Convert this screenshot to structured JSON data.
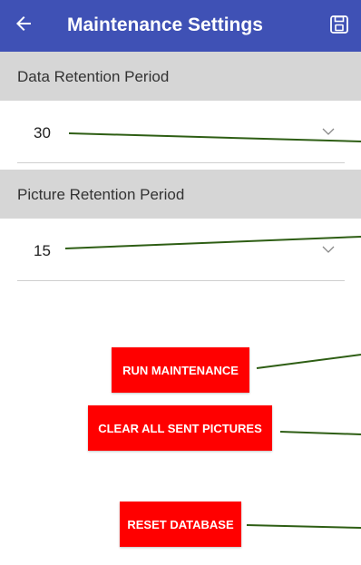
{
  "app_bar": {
    "title": "Maintenance Settings",
    "back_icon": "arrow-left-icon",
    "save_icon": "floppy-disk-icon",
    "color": "#3f51b5"
  },
  "data_retention": {
    "label": "Data Retention Period",
    "value": "30"
  },
  "picture_retention": {
    "label": "Picture Retention Period",
    "value": "15"
  },
  "buttons": {
    "run_maintenance": "RUN MAINTENANCE",
    "clear_pictures": "CLEAR ALL SENT PICTURES",
    "reset_database": "RESET DATABASE",
    "color": "#ff0000"
  },
  "callout_color": "#2e5e14"
}
